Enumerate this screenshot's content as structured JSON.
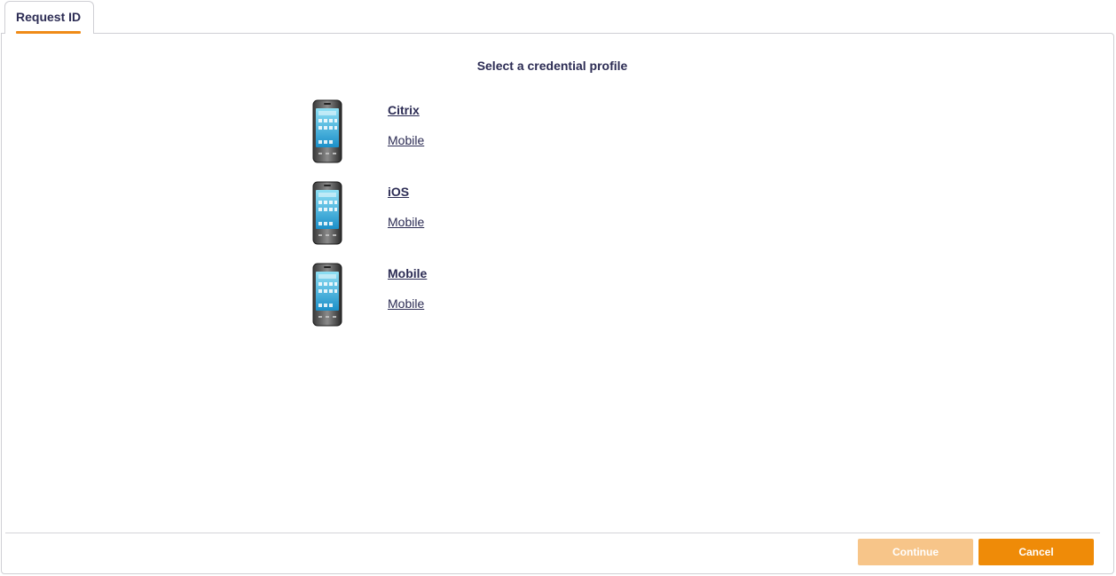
{
  "tabs": [
    {
      "label": "Request ID",
      "active": true
    }
  ],
  "main": {
    "heading": "Select a credential profile",
    "profiles": [
      {
        "name": "Citrix",
        "type": "Mobile",
        "icon": "smartphone-icon"
      },
      {
        "name": "iOS",
        "type": "Mobile",
        "icon": "smartphone-icon"
      },
      {
        "name": "Mobile",
        "type": "Mobile",
        "icon": "smartphone-icon"
      }
    ]
  },
  "footer": {
    "continue_label": "Continue",
    "cancel_label": "Cancel"
  },
  "colors": {
    "accent": "#ef8b17",
    "accent_disabled": "#f7c589",
    "text": "#2c2c54",
    "border": "#cfcfd4"
  }
}
